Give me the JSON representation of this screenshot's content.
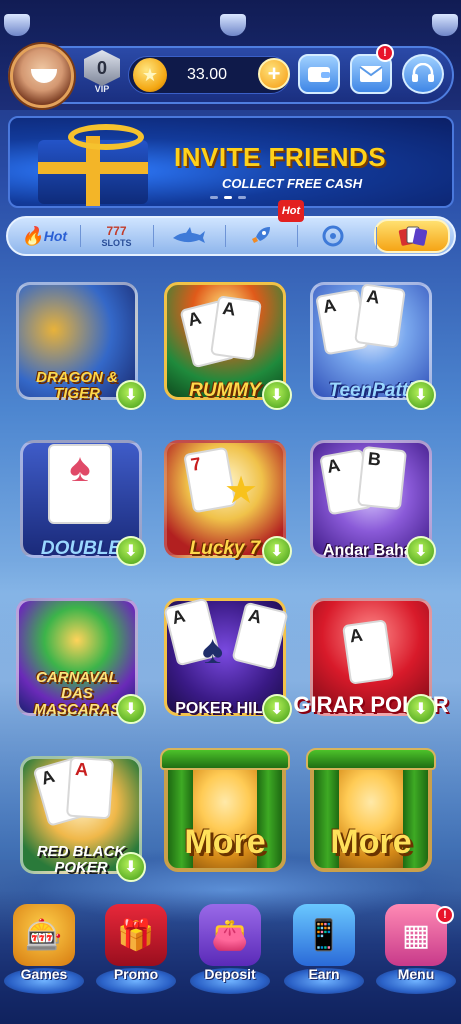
{
  "header": {
    "vip_level": "0",
    "vip_label": "VIP",
    "balance": "33.00",
    "mail_badge": "!"
  },
  "banner": {
    "title": "INVITE FRIENDS",
    "subtitle": "COLLECT FREE CASH",
    "page_count": 3,
    "active_page": 2
  },
  "categories": {
    "hot_label": "Hot",
    "slots_label": "SLOTS",
    "hot_badge": "Hot",
    "icons": [
      "flame-icon",
      "slot-machine-icon",
      "shark-icon",
      "rocket-icon",
      "wheel-icon",
      "cards-icon"
    ],
    "active_index": 5
  },
  "games": [
    {
      "title": "DRAGON & TIGER",
      "download": true
    },
    {
      "title": "RUMMY",
      "download": true
    },
    {
      "title": "TeenPatti",
      "download": true
    },
    {
      "title": "DOUBLE",
      "download": true
    },
    {
      "title": "Lucky 7",
      "download": true
    },
    {
      "title": "Andar Bahar",
      "download": true
    },
    {
      "title": "CARNAVAL DAS MASCARAS",
      "download": true
    },
    {
      "title": "POKER HILO",
      "download": true
    },
    {
      "title": "GIRAR POKER",
      "download": true
    },
    {
      "title": "RED BLACK POKER",
      "download": true
    },
    {
      "title": "More",
      "download": false
    },
    {
      "title": "More",
      "download": false
    }
  ],
  "nav": {
    "items": [
      {
        "label": "Games",
        "icon": "slot-machine-icon"
      },
      {
        "label": "Promo",
        "icon": "gift-icon"
      },
      {
        "label": "Deposit",
        "icon": "wallet-icon"
      },
      {
        "label": "Earn",
        "icon": "phone-coins-icon"
      },
      {
        "label": "Menu",
        "icon": "menu-grid-icon"
      }
    ],
    "menu_badge": "!"
  },
  "colors": {
    "accent_gold": "#ffd11a",
    "download_green": "#3f9a16",
    "badge_red": "#e8142a",
    "primary_blue": "#2b4aa8"
  }
}
